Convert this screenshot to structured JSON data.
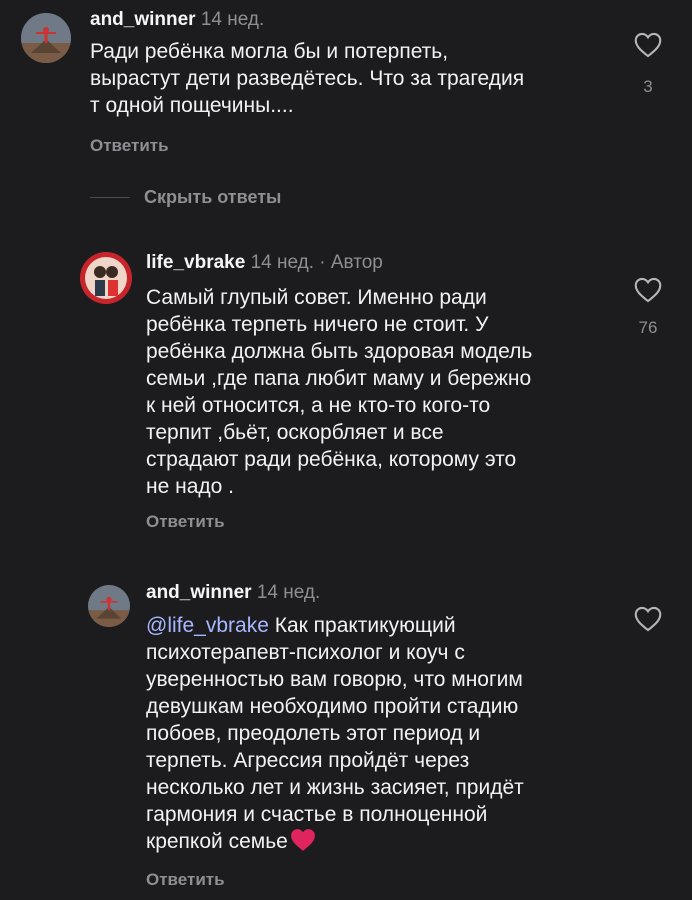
{
  "comments": [
    {
      "username": "and_winner",
      "time": "14 нед.",
      "text": "Ради ребёнка могла бы и потерпеть,\nвырастут дети разведётесь. Что за трагедия\nт одной пощечины....",
      "reply_label": "Ответить",
      "likes": "3"
    },
    {
      "username": "life_vbrake",
      "time": "14 нед.",
      "author_badge": "· Автор",
      "text": "Самый глупый совет. Именно ради\nребёнка терпеть ничего не стоит. У\nребёнка должна быть здоровая модель\nсемьи ,где папа любит маму и бережно\nк ней относится, а не кто-то кого-то\nтерпит ,бьёт, оскорбляет и все\nстрадают ради ребёнка, которому это\nне надо .",
      "reply_label": "Ответить",
      "likes": "76"
    },
    {
      "username": "and_winner",
      "time": "14 нед.",
      "mention": "@life_vbrake",
      "text": " Как практикующий\nпсихотерапевт-психолог и коуч с\nуверенностью вам  говорю, что многим\nдевушкам необходимо пройти стадию\nпобоев, преодолеть этот период и\nтерпеть. Агрессия пройдёт через\nнесколько лет и жизнь засияет, придёт\nгармония и счастье в полноценной\nкрепкой семье",
      "reply_label": "Ответить"
    }
  ],
  "hide_replies_label": "Скрыть ответы",
  "colors": {
    "background": "#1c1c1f",
    "secondary_text": "#8e8e93",
    "mention": "#a8b8ff",
    "heart": "#e0245e"
  },
  "icons": {
    "like": "heart-outline-icon",
    "emoji": "red-heart-emoji"
  }
}
